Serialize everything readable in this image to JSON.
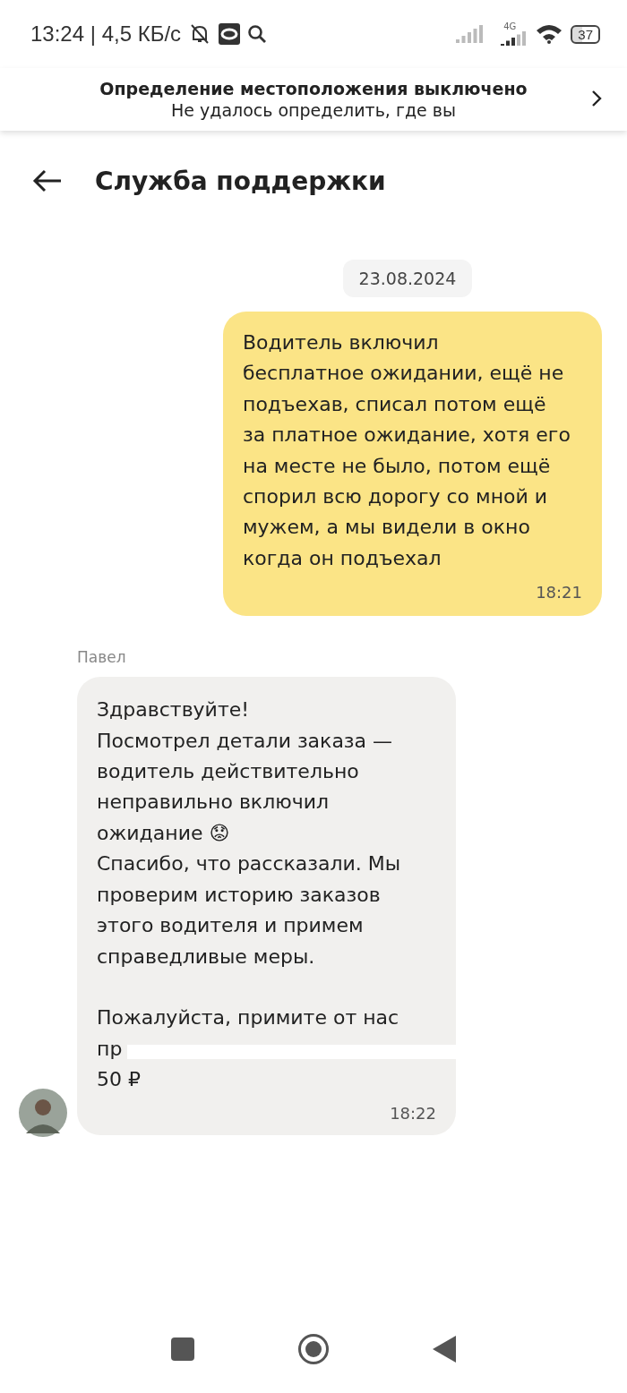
{
  "status_bar": {
    "time": "13:24",
    "separator": "|",
    "speed": "4,5 КБ/с",
    "network": "4G",
    "battery": "37"
  },
  "location_banner": {
    "title": "Определение местоположения выключено",
    "subtitle": "Не удалось определить, где вы"
  },
  "header": {
    "title": "Служба поддержки"
  },
  "date": "23.08.2024",
  "messages": [
    {
      "kind": "outgoing",
      "text": "Водитель включил\nбесплатное ожидании, ещё не\nподъехав, списал потом ещё\nза платное ожидание, хотя его\nна месте не было, потом ещё\nспорил всю дорогу со мной и\nмужем, а мы видели в окно\nкогда он подъехал",
      "time": "18:21"
    },
    {
      "kind": "incoming",
      "sender": "Павел",
      "text": "Здравствуйте!\nПосмотрел детали заказа —\nводитель действительно\nнеправильно включил\nожидание 😟\nСпасибо, что рассказали. Мы\nпроверим историю заказов\nэтого водителя и примем\nсправедливые меры.\n\nПожалуйста, примите от нас",
      "redacted_start": "пр",
      "tail": "50 ₽",
      "time": "18:22"
    }
  ]
}
